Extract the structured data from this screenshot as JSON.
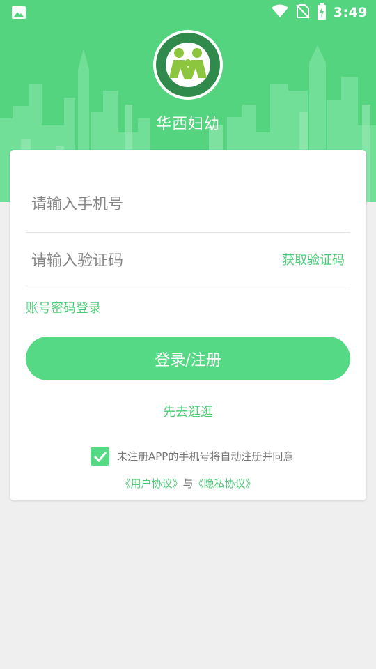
{
  "status_bar": {
    "time": "3:49",
    "icons": [
      "image-icon",
      "wifi-icon",
      "no-sim-icon",
      "battery-charging-icon"
    ]
  },
  "header": {
    "app_title": "华西妇幼",
    "logo_alt": "四川大学华西第二医院 WEST CHINA SECOND UNIV.HOSPITAL,SCU"
  },
  "login": {
    "phone_placeholder": "请输入手机号",
    "code_placeholder": "请输入验证码",
    "get_code_label": "获取验证码",
    "password_login_label": "账号密码登录",
    "submit_label": "登录/注册",
    "browse_label": "先去逛逛",
    "consent_text": "未注册APP的手机号将自动注册并同意",
    "consent_checked": true,
    "user_agreement": "《用户协议》",
    "conjunction": "与",
    "privacy_agreement": "《隐私协议》"
  },
  "colors": {
    "brand_green": "#55d47f",
    "link_green": "#4ccb77",
    "background": "#efefef"
  }
}
